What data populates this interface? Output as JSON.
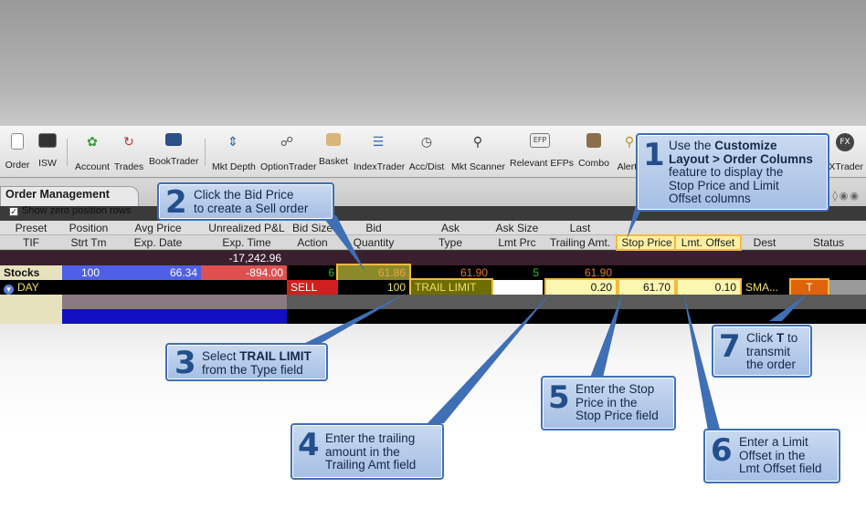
{
  "toolbar": {
    "items": [
      {
        "label": "Order",
        "icon": "order-icon"
      },
      {
        "label": "ISW",
        "icon": "isw-icon"
      },
      {
        "label": "Account",
        "icon": "account-icon"
      },
      {
        "label": "Trades",
        "icon": "trades-icon"
      },
      {
        "label": "BookTrader",
        "icon": "book-icon"
      },
      {
        "label": "Mkt Depth",
        "icon": "depth-icon"
      },
      {
        "label": "OptionTrader",
        "icon": "option-icon"
      },
      {
        "label": "Basket",
        "icon": "basket-icon"
      },
      {
        "label": "IndexTrader",
        "icon": "index-icon"
      },
      {
        "label": "Acc/Dist",
        "icon": "accdist-icon"
      },
      {
        "label": "Mkt Scanner",
        "icon": "scanner-icon"
      },
      {
        "label": "Relevant EFPs",
        "icon": "efp-icon",
        "icon_text": "EFP"
      },
      {
        "label": "Combo",
        "icon": "combo-icon"
      },
      {
        "label": "Alerts",
        "icon": "alerts-icon"
      },
      {
        "label": "FXTrader",
        "icon": "fx-icon",
        "icon_text": "FX"
      }
    ]
  },
  "order_mgmt": {
    "title": "Order Management",
    "checkbox_label": "Show zero position rows",
    "header_row1": [
      "Preset",
      "Position",
      "Avg Price",
      "Unrealized P&L",
      "Bid Size",
      "Bid",
      "Ask",
      "Ask Size",
      "Last"
    ],
    "header_row2": [
      "TIF",
      "Strt Tm",
      "Exp. Date",
      "Exp. Time",
      "Action",
      "Quantity",
      "Type",
      "Lmt Prc",
      "Trailing Amt.",
      "Stop Price",
      "Lmt. Offset",
      "Dest",
      "Status"
    ],
    "summary_value": "-17,242.96",
    "stocks_row": {
      "label": "Stocks",
      "position": "100",
      "avg_price": "66.34",
      "unrealized": "-894.00",
      "bid_size": "6",
      "bid": "61.86",
      "ask": "61.90",
      "ask_size": "5",
      "last": "61.90"
    },
    "order_row": {
      "tif": "DAY",
      "action": "SELL",
      "quantity": "100",
      "type": "TRAIL LIMIT",
      "trailing_amt": "0.20",
      "stop_price": "61.70",
      "lmt_offset": "0.10",
      "dest": "SMA...",
      "status": "T"
    }
  },
  "callouts": [
    {
      "num": "1",
      "line1_pre": "Use the ",
      "line1_bold": "Customize",
      "line2_bold": "Layout > Order Columns",
      "line3": "feature to display the",
      "line4": "Stop Price and Limit",
      "line5": "Offset columns"
    },
    {
      "num": "2",
      "line1": "Click the Bid Price",
      "line2": "to create a Sell order"
    },
    {
      "num": "3",
      "line1_pre": "Select ",
      "line1_bold": "TRAIL LIMIT",
      "line2": "from the Type field"
    },
    {
      "num": "4",
      "line1": "Enter the trailing",
      "line2": "amount in the",
      "line3": "Trailing Amt field"
    },
    {
      "num": "5",
      "line1": "Enter the Stop",
      "line2": "Price in the",
      "line3": "Stop Price field"
    },
    {
      "num": "6",
      "line1": "Enter a Limit",
      "line2": "Offset in the",
      "line3": "Lmt Offset field"
    },
    {
      "num": "7",
      "line1_pre": "Click ",
      "line1_bold": "T",
      "line1_post": " to",
      "line2": "transmit",
      "line3": "the order"
    }
  ],
  "colors": {
    "callout_border": "#3f6fb5",
    "callout_fill": "#b7cdea",
    "highlight": "#f4b942",
    "sell": "#d11f1f",
    "trail_limit_bg": "#6d6d00",
    "status_bg": "#e0620a"
  }
}
